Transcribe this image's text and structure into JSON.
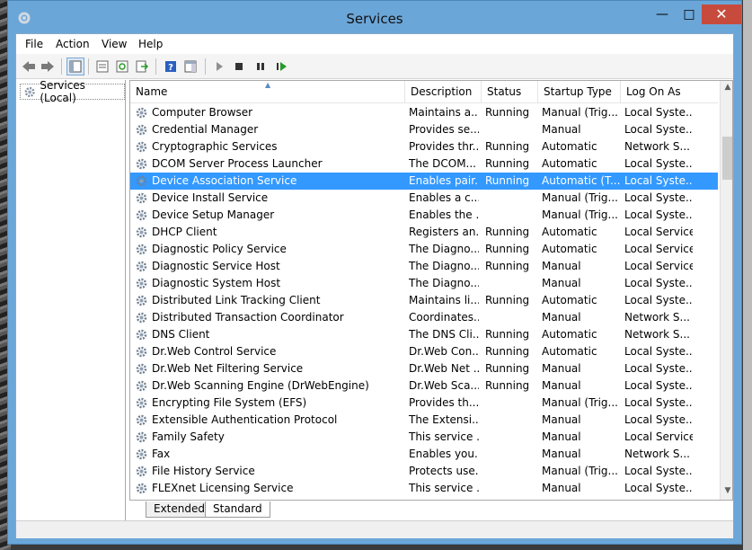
{
  "window": {
    "title": "Services",
    "minimize_glyph": "—",
    "maximize_glyph": "□",
    "close_glyph": "✕"
  },
  "menu": [
    {
      "label": "File"
    },
    {
      "label": "Action"
    },
    {
      "label": "View"
    },
    {
      "label": "Help"
    }
  ],
  "toolbar": {
    "icons": [
      "back-arrow-icon",
      "forward-arrow-icon",
      "show-hide-console-tree-icon",
      "properties-icon",
      "refresh-icon",
      "export-list-icon",
      "help-icon",
      "show-hide-action-pane-icon",
      "start-service-icon",
      "stop-service-icon",
      "pause-service-icon",
      "restart-service-icon"
    ]
  },
  "tree": {
    "root_label": "Services (Local)"
  },
  "table": {
    "columns": [
      "Name",
      "Description",
      "Status",
      "Startup Type",
      "Log On As"
    ],
    "rows": [
      {
        "name": "Computer Browser",
        "desc": "Maintains a...",
        "status": "Running",
        "startup": "Manual (Trig...",
        "logon": "Local Syste..."
      },
      {
        "name": "Credential Manager",
        "desc": "Provides se...",
        "status": "",
        "startup": "Manual",
        "logon": "Local Syste..."
      },
      {
        "name": "Cryptographic Services",
        "desc": "Provides thr...",
        "status": "Running",
        "startup": "Automatic",
        "logon": "Network S..."
      },
      {
        "name": "DCOM Server Process Launcher",
        "desc": "The DCOM...",
        "status": "Running",
        "startup": "Automatic",
        "logon": "Local Syste..."
      },
      {
        "name": "Device Association Service",
        "desc": "Enables pair...",
        "status": "Running",
        "startup": "Automatic (T...",
        "logon": "Local Syste...",
        "selected": true
      },
      {
        "name": "Device Install Service",
        "desc": "Enables a c...",
        "status": "",
        "startup": "Manual (Trig...",
        "logon": "Local Syste..."
      },
      {
        "name": "Device Setup Manager",
        "desc": "Enables the ...",
        "status": "",
        "startup": "Manual (Trig...",
        "logon": "Local Syste..."
      },
      {
        "name": "DHCP Client",
        "desc": "Registers an...",
        "status": "Running",
        "startup": "Automatic",
        "logon": "Local Service"
      },
      {
        "name": "Diagnostic Policy Service",
        "desc": "The Diagno...",
        "status": "Running",
        "startup": "Automatic",
        "logon": "Local Service"
      },
      {
        "name": "Diagnostic Service Host",
        "desc": "The Diagno...",
        "status": "Running",
        "startup": "Manual",
        "logon": "Local Service"
      },
      {
        "name": "Diagnostic System Host",
        "desc": "The Diagno...",
        "status": "",
        "startup": "Manual",
        "logon": "Local Syste..."
      },
      {
        "name": "Distributed Link Tracking Client",
        "desc": "Maintains li...",
        "status": "Running",
        "startup": "Automatic",
        "logon": "Local Syste..."
      },
      {
        "name": "Distributed Transaction Coordinator",
        "desc": "Coordinates...",
        "status": "",
        "startup": "Manual",
        "logon": "Network S..."
      },
      {
        "name": "DNS Client",
        "desc": "The DNS Cli...",
        "status": "Running",
        "startup": "Automatic",
        "logon": "Network S..."
      },
      {
        "name": "Dr.Web Control Service",
        "desc": "Dr.Web Con...",
        "status": "Running",
        "startup": "Automatic",
        "logon": "Local Syste..."
      },
      {
        "name": "Dr.Web Net Filtering Service",
        "desc": "Dr.Web Net ...",
        "status": "Running",
        "startup": "Manual",
        "logon": "Local Syste..."
      },
      {
        "name": "Dr.Web Scanning Engine (DrWebEngine)",
        "desc": "Dr.Web Sca...",
        "status": "Running",
        "startup": "Manual",
        "logon": "Local Syste..."
      },
      {
        "name": "Encrypting File System (EFS)",
        "desc": "Provides th...",
        "status": "",
        "startup": "Manual (Trig...",
        "logon": "Local Syste..."
      },
      {
        "name": "Extensible Authentication Protocol",
        "desc": "The Extensi...",
        "status": "",
        "startup": "Manual",
        "logon": "Local Syste..."
      },
      {
        "name": "Family Safety",
        "desc": "This service ...",
        "status": "",
        "startup": "Manual",
        "logon": "Local Service"
      },
      {
        "name": "Fax",
        "desc": "Enables you...",
        "status": "",
        "startup": "Manual",
        "logon": "Network S..."
      },
      {
        "name": "File History Service",
        "desc": "Protects use...",
        "status": "",
        "startup": "Manual (Trig...",
        "logon": "Local Syste..."
      },
      {
        "name": "FLEXnet Licensing Service",
        "desc": "This service ...",
        "status": "",
        "startup": "Manual",
        "logon": "Local Syste..."
      }
    ]
  },
  "tabs": [
    {
      "label": "Extended"
    },
    {
      "label": "Standard",
      "active": true
    }
  ],
  "colors": {
    "selection": "#3399ff",
    "title_bg": "#6ba6d8",
    "close_btn": "#c74b3c"
  }
}
